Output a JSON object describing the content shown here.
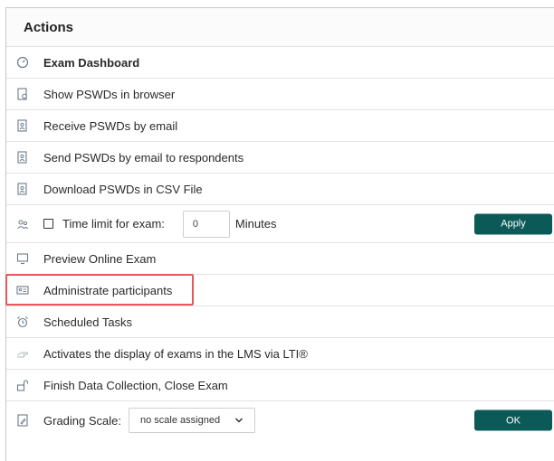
{
  "panel": {
    "title": "Actions"
  },
  "rows": {
    "exam_dashboard": {
      "label": "Exam Dashboard",
      "icon": "gauge-icon"
    },
    "show_pswds": {
      "label": "Show PSWDs in browser",
      "icon": "document-browser-icon"
    },
    "receive_pswds": {
      "label": "Receive PSWDs by email",
      "icon": "document-user-icon"
    },
    "send_pswds": {
      "label": "Send PSWDs by email to respondents",
      "icon": "document-user-icon"
    },
    "download_pswds": {
      "label": "Download PSWDs in CSV File",
      "icon": "document-user-icon"
    },
    "time_limit": {
      "label": "Time limit for exam:",
      "checked": false,
      "value": "0",
      "unit": "Minutes",
      "button": "Apply",
      "icon": "users-icon"
    },
    "preview": {
      "label": "Preview Online Exam",
      "icon": "monitor-icon"
    },
    "administrate": {
      "label": "Administrate participants",
      "icon": "id-card-icon"
    },
    "scheduled": {
      "label": "Scheduled Tasks",
      "icon": "alarm-clock-icon"
    },
    "lti": {
      "label": "Activates the display of exams in the LMS via LTI®",
      "icon": "hand-pointer-icon"
    },
    "finish": {
      "label": "Finish Data Collection, Close Exam",
      "icon": "unlocked-icon"
    },
    "grading": {
      "label": "Grading Scale:",
      "selected": "no scale assigned",
      "button": "OK",
      "icon": "document-edit-icon"
    }
  },
  "colors": {
    "accent": "#0b5a58",
    "highlight": "#e8585b",
    "icon": "#6b7a8a"
  }
}
